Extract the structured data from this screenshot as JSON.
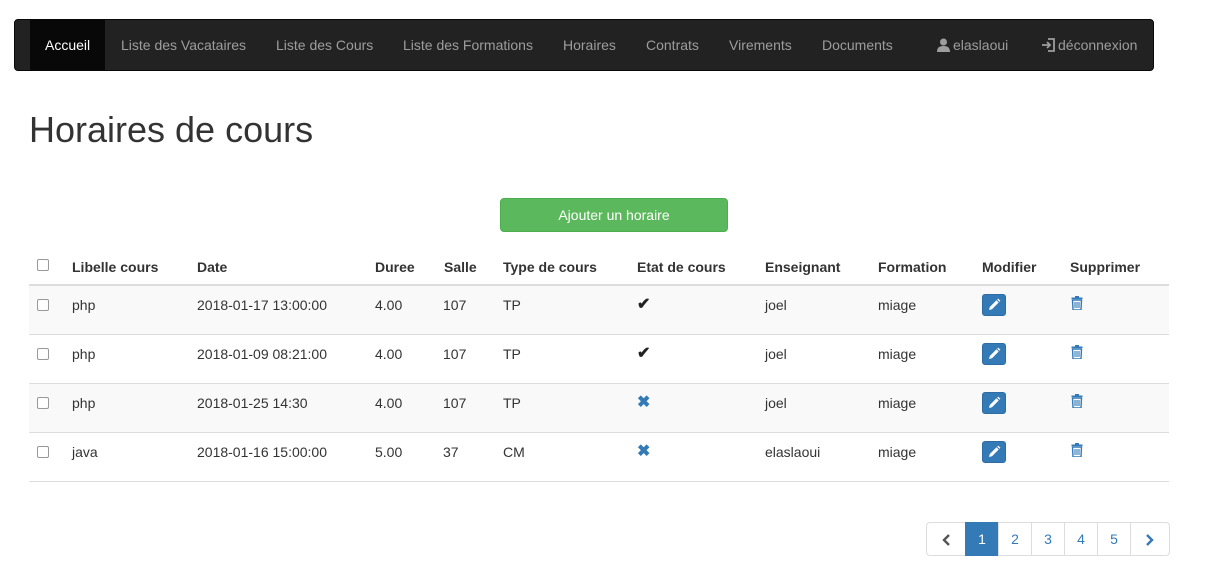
{
  "navbar": {
    "items": [
      {
        "label": "Accueil",
        "active": true
      },
      {
        "label": "Liste des Vacataires"
      },
      {
        "label": "Liste des Cours"
      },
      {
        "label": "Liste des Formations"
      },
      {
        "label": "Horaires"
      },
      {
        "label": "Contrats"
      },
      {
        "label": "Virements"
      },
      {
        "label": "Documents"
      }
    ],
    "user": {
      "label": "elaslaoui",
      "icon": "user-icon"
    },
    "logout": {
      "label": "déconnexion",
      "icon": "logout-icon"
    }
  },
  "page": {
    "title": "Horaires de cours",
    "add_button": "Ajouter un horaire"
  },
  "table": {
    "columns": [
      "Libelle cours",
      "Date",
      "Duree",
      "Salle",
      "Type de cours",
      "Etat de cours",
      "Enseignant",
      "Formation",
      "Modifier",
      "Supprimer"
    ],
    "rows": [
      {
        "libelle": "php",
        "date": "2018-01-17 13:00:00",
        "duree": "4.00",
        "salle": "107",
        "type": "TP",
        "etat": "check",
        "etat_glyph": "✔",
        "enseignant": "joel",
        "formation": "miage"
      },
      {
        "libelle": "php",
        "date": "2018-01-09 08:21:00",
        "duree": "4.00",
        "salle": "107",
        "type": "TP",
        "etat": "check",
        "etat_glyph": "✔",
        "enseignant": "joel",
        "formation": "miage"
      },
      {
        "libelle": "php",
        "date": "2018-01-25 14:30",
        "duree": "4.00",
        "salle": "107",
        "type": "TP",
        "etat": "cross",
        "etat_glyph": "✖",
        "enseignant": "joel",
        "formation": "miage"
      },
      {
        "libelle": "java",
        "date": "2018-01-16 15:00:00",
        "duree": "5.00",
        "salle": "37",
        "type": "CM",
        "etat": "cross",
        "etat_glyph": "✖",
        "enseignant": "elaslaoui",
        "formation": "miage"
      }
    ]
  },
  "pagination": {
    "prev_icon": "chevron-left-icon",
    "pages": [
      "1",
      "2",
      "3",
      "4",
      "5"
    ],
    "current": "1",
    "next_icon": "chevron-right-icon"
  },
  "colors": {
    "navbar_bg": "#222222",
    "primary": "#337ab7",
    "success": "#5cb85c"
  }
}
